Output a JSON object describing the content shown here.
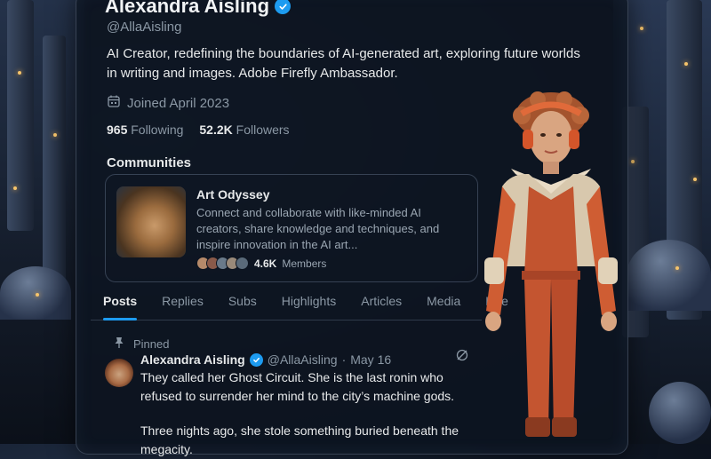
{
  "profile": {
    "name": "Alexandra Aisling",
    "handle": "@AllaAisling",
    "bio": "AI Creator, redefining the boundaries of AI-generated art, exploring future worlds in writing and images. Adobe Firefly Ambassador.",
    "joined": "Joined April 2023",
    "following_count": "965",
    "following_label": "Following",
    "followers_count": "52.2K",
    "followers_label": "Followers"
  },
  "communities": {
    "title": "Communities",
    "item": {
      "name": "Art Odyssey",
      "description": "Connect and collaborate with like-minded AI creators, share knowledge and techniques, and inspire innovation in the AI art...",
      "members_count": "4.6K",
      "members_label": "Members"
    }
  },
  "tabs": [
    "Posts",
    "Replies",
    "Subs",
    "Highlights",
    "Articles",
    "Media",
    "Like"
  ],
  "active_tab": "Posts",
  "post": {
    "pinned_label": "Pinned",
    "author": "Alexandra Aisling",
    "handle": "@AllaAisling",
    "separator": "·",
    "date": "May 16",
    "text_1": "They called her Ghost Circuit. She is the last ronin who refused to surrender her mind to the city’s machine gods.",
    "text_2": "Three nights ago, she stole something buried beneath the megacity."
  },
  "colors": {
    "accent": "#1d9bf0",
    "panel": "#0d1420",
    "text_primary": "#e7e9ea",
    "text_secondary": "#8b98a5"
  },
  "icons": {
    "verified": "verified-badge-icon",
    "calendar": "calendar-icon",
    "pin": "pin-icon",
    "grok": "grok-icon"
  }
}
